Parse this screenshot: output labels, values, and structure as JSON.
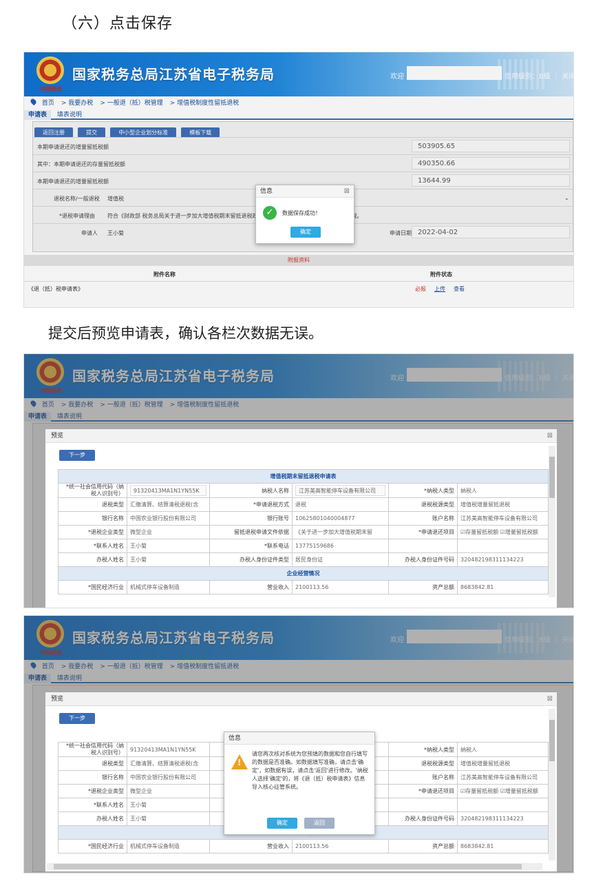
{
  "headings": {
    "step": "（六）点击保存",
    "review": "提交后预览申请表，确认各栏次数据无误。"
  },
  "site": {
    "title": "国家税务总局江苏省电子税务局",
    "emblem_text": "中国税务",
    "welcome": "欢迎",
    "credit_level": "信用级别：B级 ｜ 关闭"
  },
  "breadcrumb": [
    "首页",
    "我要办税",
    "一般退（抵）税管理",
    "增值税制度性留抵退税"
  ],
  "tabs": [
    "申请表",
    "填表说明"
  ],
  "toolbar": [
    "返回注册",
    "提交",
    "中小型企业划分标准",
    "模板下载"
  ],
  "form": {
    "rows": [
      {
        "label": "本期申请退还的增量留抵税额",
        "value": "503905.65"
      },
      {
        "label": "其中：本期申请退还的存量留抵税额",
        "value": "490350.66"
      },
      {
        "label": "本期申请退还的增量留抵税额",
        "value": "13644.99"
      }
    ],
    "refund_type_label": "退税名称/一般退税",
    "refund_type_value": "增值税",
    "reason_label": "*退税申请理由",
    "reason_value": "符合《财政部 税务总局关于进一步加大增值税期末留抵退税政策实施力度的公告》规定，申请留抵退税。",
    "applicant_label": "申请人",
    "applicant_value": "王小菊",
    "date_label": "申请日期",
    "date_value": "2022-04-02"
  },
  "attachments": {
    "title": "附报资料",
    "col_name": "附件名称",
    "col_status": "附件状态",
    "row_name": "《退（抵）税申请表》",
    "actions": [
      "必报",
      "上传",
      "查看"
    ]
  },
  "save_dialog": {
    "title": "信息",
    "message": "数据保存成功！",
    "ok": "确定"
  },
  "preview": {
    "title": "预览",
    "next": "下一步",
    "table_title": "增值税期末留抵退税申请表",
    "section2": "企业经营情况",
    "rows": [
      [
        "*统一社会信用代码（纳税人识别号）",
        "91320413MA1N1YN55K",
        "纳税人名称",
        "江苏美高智能停车设备有限公司",
        "*纳税人类型",
        "纳税人"
      ],
      [
        "退税类型",
        "汇缴清算、结算清税退税(含",
        "*申请退税方式",
        "退税",
        "退税税源类型",
        "增值税增量留抵退税"
      ],
      [
        "银行名称",
        "中国农业银行股份有限公司",
        "银行账号",
        "10625801040004877",
        "账户名称",
        "江苏美高智能停车设备有限公司"
      ],
      [
        "*退税企业类型",
        "微型企业",
        "留抵退税申请文件依据",
        "《关于进一步加大增值税期末留",
        "*申请退还项目",
        "☑存量留抵税额 ☑增量留抵税额"
      ],
      [
        "*联系人姓名",
        "王小菊",
        "*联系电话",
        "13775159686",
        "",
        ""
      ],
      [
        "办税人姓名",
        "王小菊",
        "办税人身份证件类型",
        "居民身份证",
        "办税人身份证件号码",
        "320482198311134223"
      ]
    ],
    "partial_row": [
      "*国民经济行业",
      "机械式停车设备制造",
      "营业收入",
      "2100113.56",
      "资产总额",
      "8683842.81"
    ]
  },
  "confirm_dialog": {
    "title": "信息",
    "message": "请您再次核对系统为您预填的数据和您自行填写的数据是否准确。如数据填写准确，请点击'确定'，如数据有误，请点击'返回'进行修改。'纳税人选择'确定'的，将《退（抵）税申请表》信息导入核心征管系统。",
    "ok": "确定",
    "back": "返回"
  }
}
